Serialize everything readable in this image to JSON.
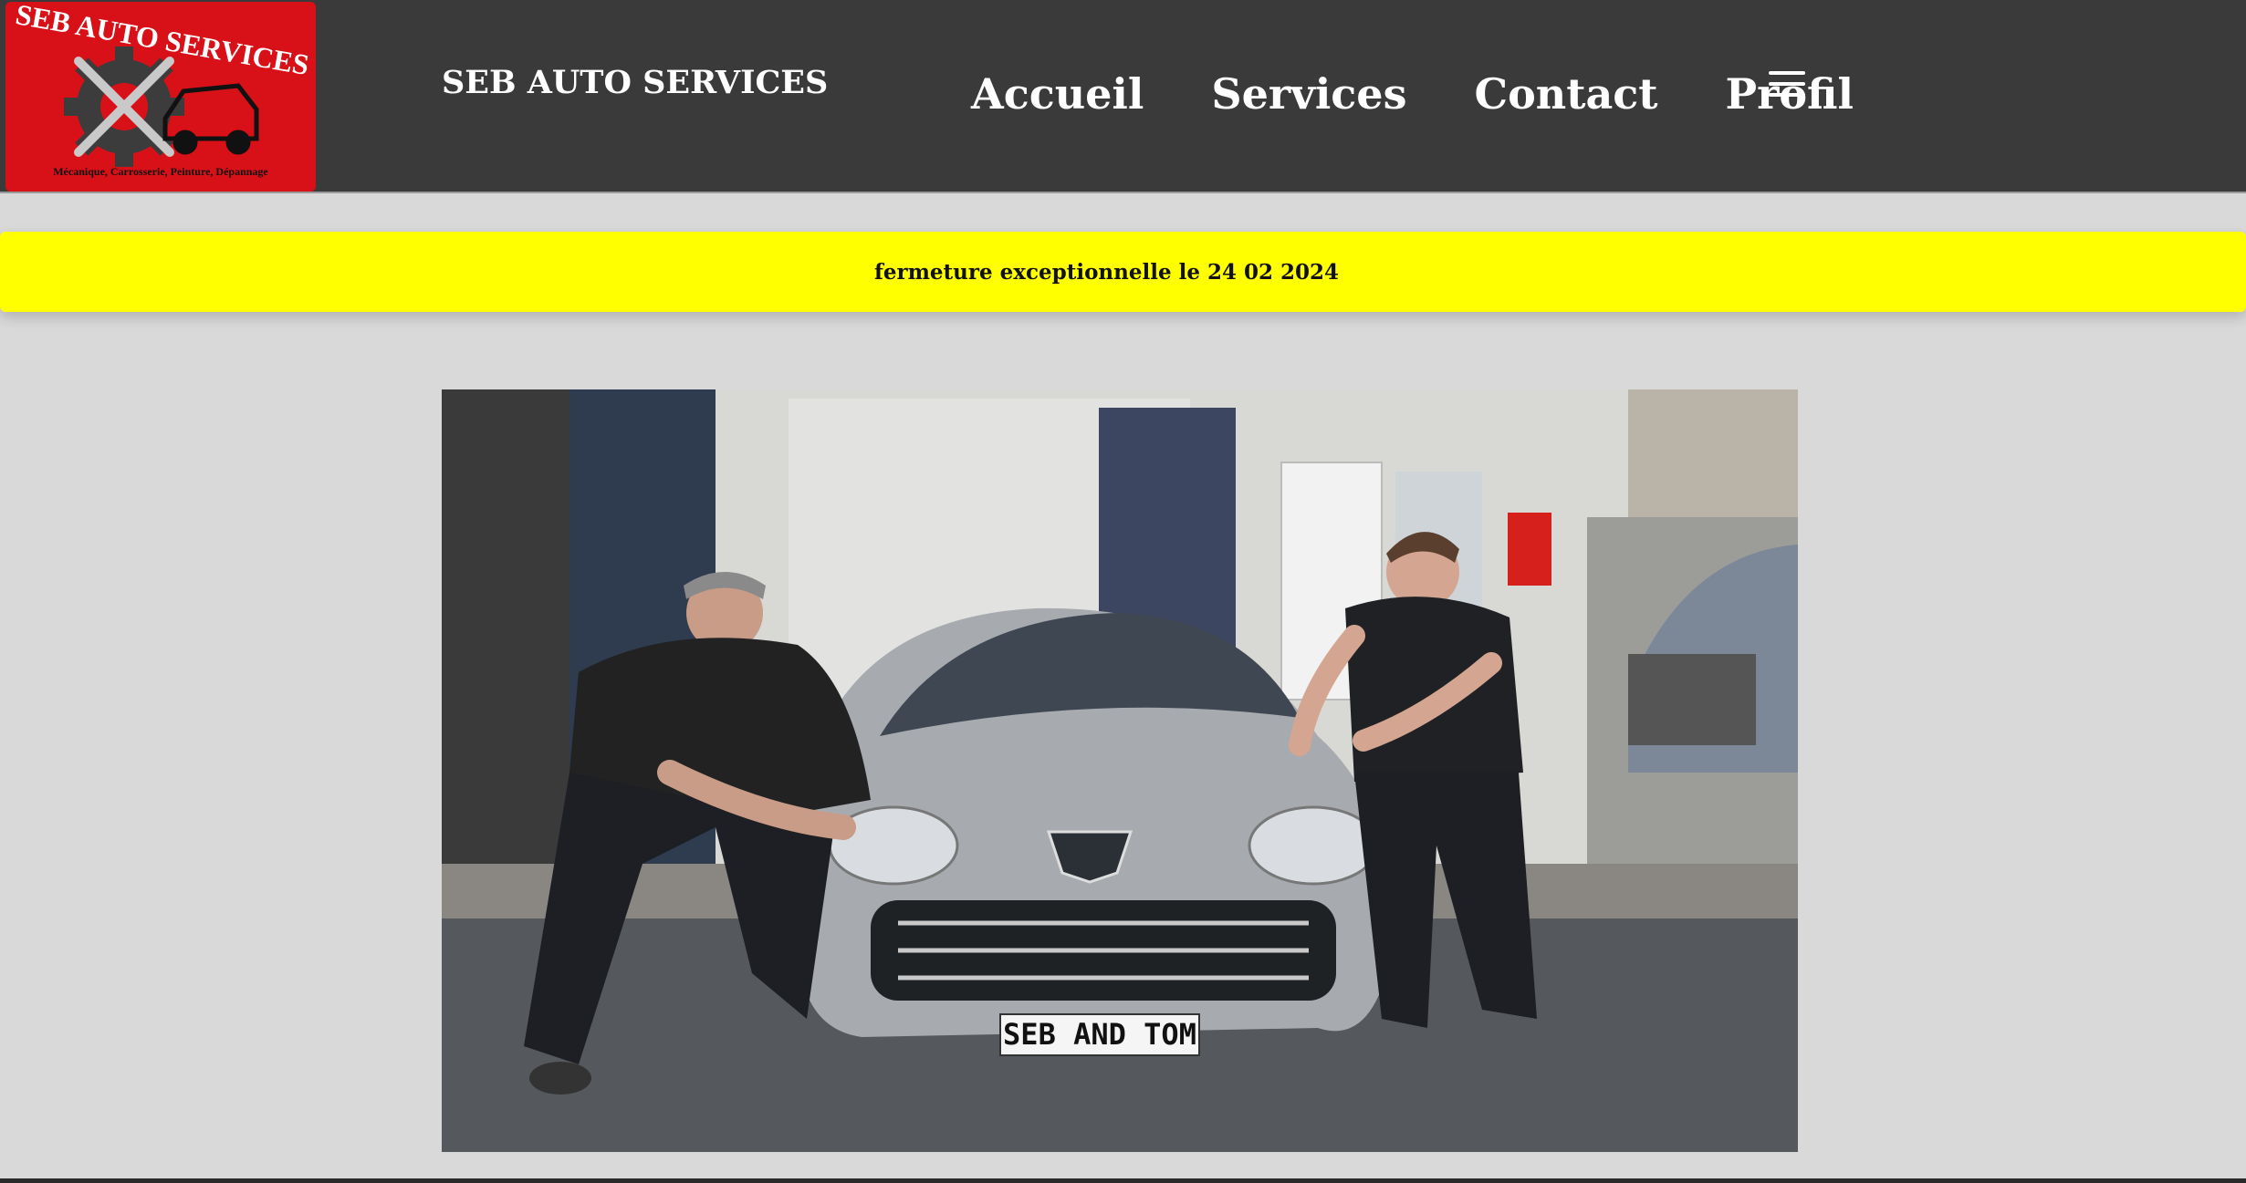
{
  "header": {
    "logo": {
      "title": "SEB AUTO SERVICES",
      "tagline": "Mécanique, Carrosserie, Peinture, Dépannage"
    },
    "site_title": "SEB AUTO SERVICES",
    "nav": [
      {
        "label": "Accueil"
      },
      {
        "label": "Services"
      },
      {
        "label": "Contact"
      },
      {
        "label": "Profil"
      }
    ],
    "menu_icon": "hamburger-menu-icon"
  },
  "banner": {
    "text": "fermeture exceptionnelle le 24 02 2024",
    "color": "#ffff00"
  },
  "hero": {
    "plate": "SEB AND TOM"
  },
  "colors": {
    "header_bg": "#3a3a3a",
    "page_bg": "#d9d9d9",
    "logo_red": "#d81119"
  }
}
